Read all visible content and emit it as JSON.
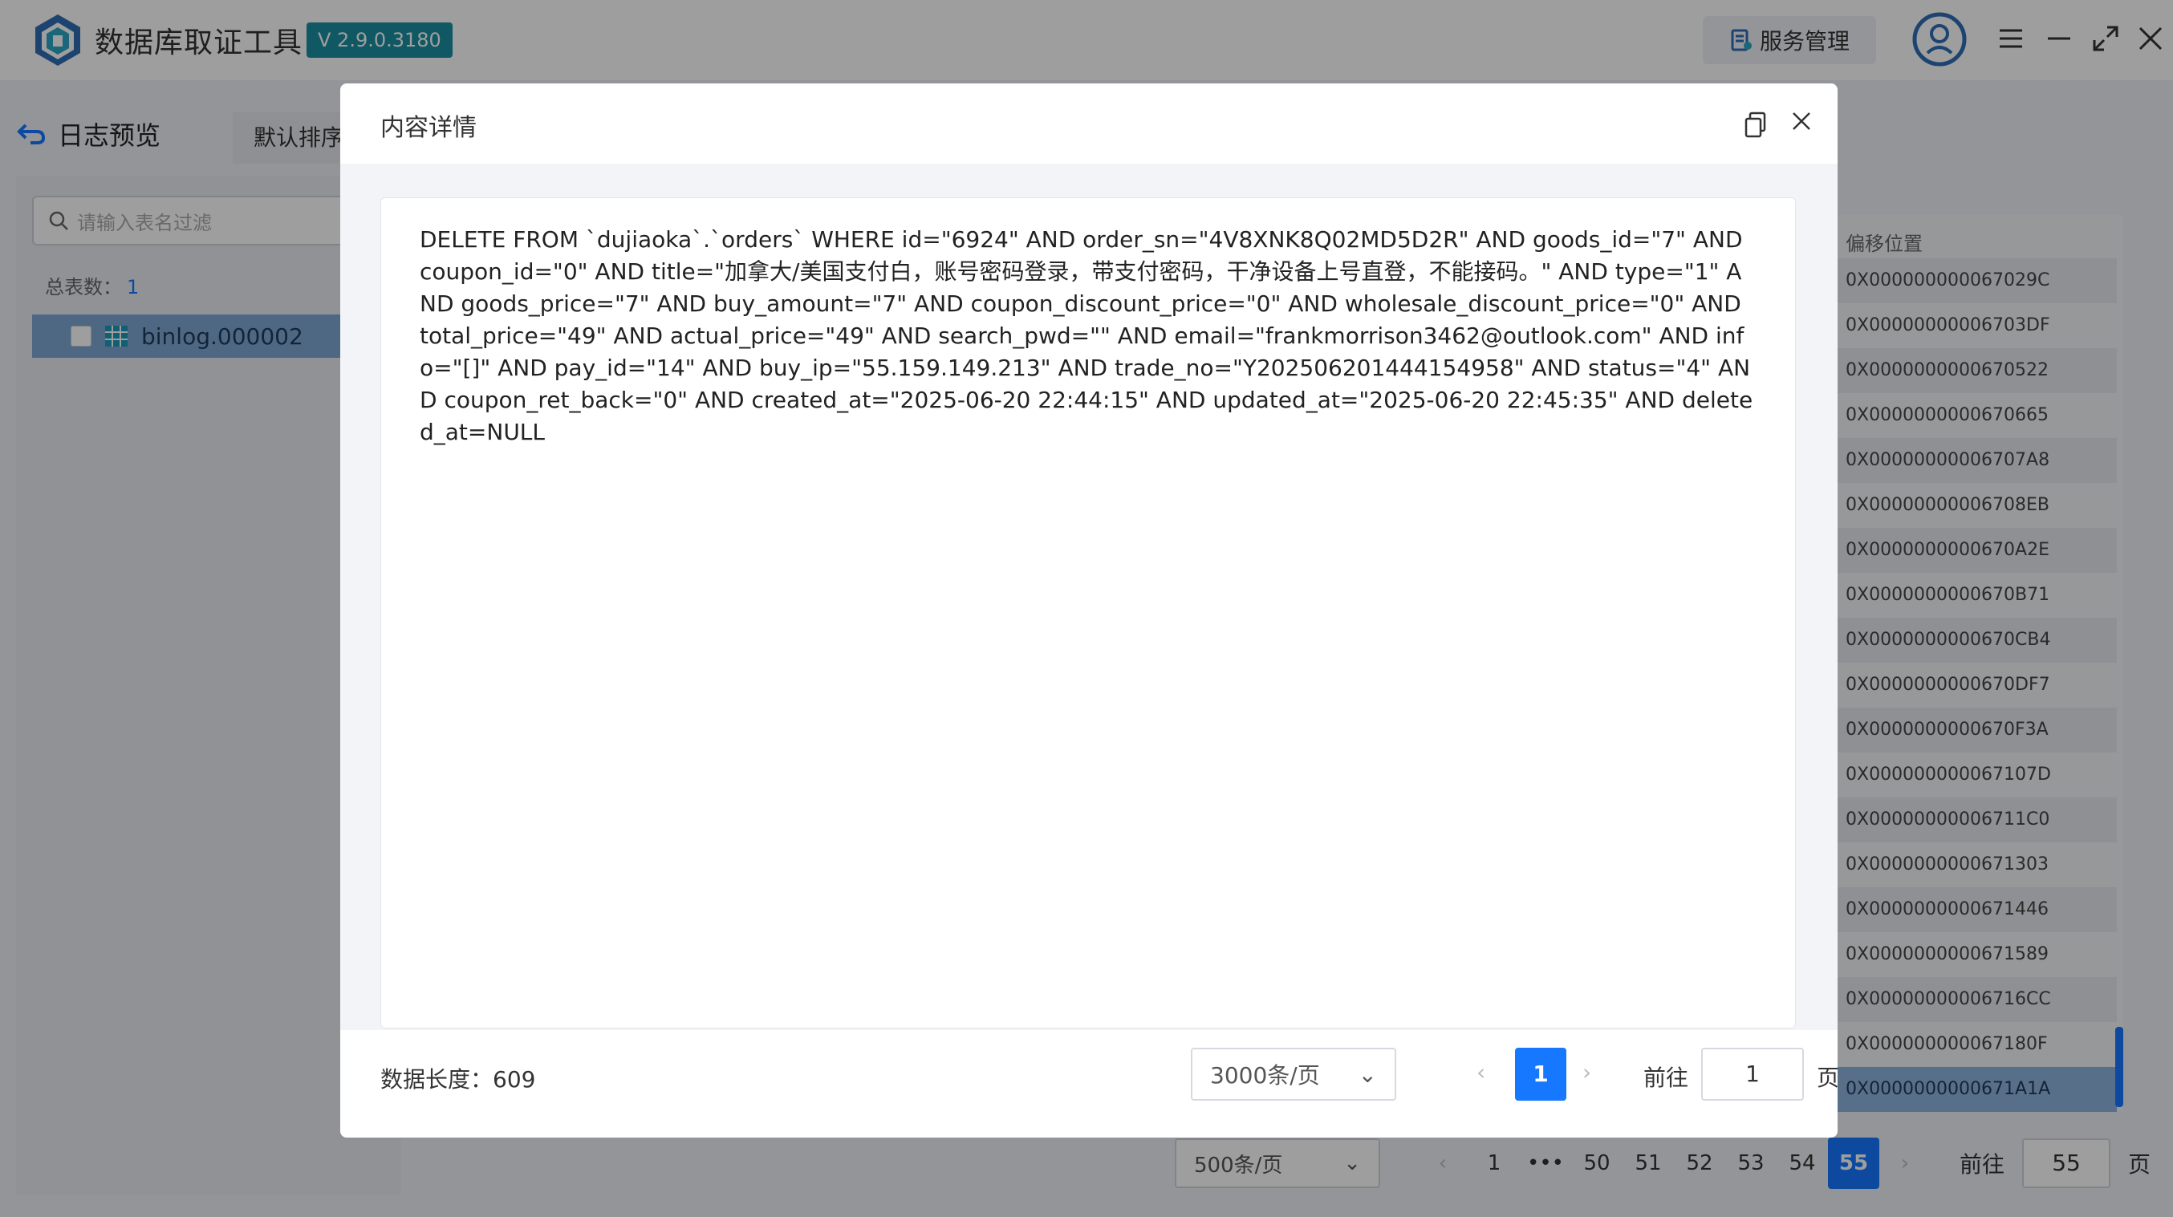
{
  "app": {
    "title": "数据库取证工具",
    "version": "V 2.9.0.3180",
    "service_button": "服务管理"
  },
  "page": {
    "back_label": "日志预览",
    "sort_tab": "默认排序",
    "filter_placeholder": "请输入表名过滤",
    "total_label": "总表数：",
    "total_count": "1",
    "tree_item": "binlog.000002",
    "offset_header": "偏移位置",
    "offsets": [
      "0X000000000067029C",
      "0X00000000006703DF",
      "0X0000000000670522",
      "0X0000000000670665",
      "0X00000000006707A8",
      "0X00000000006708EB",
      "0X0000000000670A2E",
      "0X0000000000670B71",
      "0X0000000000670CB4",
      "0X0000000000670DF7",
      "0X0000000000670F3A",
      "0X000000000067107D",
      "0X00000000006711C0",
      "0X0000000000671303",
      "0X0000000000671446",
      "0X0000000000671589",
      "0X00000000006716CC",
      "0X000000000067180F",
      "0X0000000000671A1A"
    ],
    "pager": {
      "page_size": "500条/页",
      "pages": [
        "1",
        "•••",
        "50",
        "51",
        "52",
        "53",
        "54",
        "55"
      ],
      "current": "55",
      "goto_label": "前往",
      "goto_value": "55",
      "page_suffix": "页"
    }
  },
  "dialog": {
    "title": "内容详情",
    "content": "DELETE FROM `dujiaoka`.`orders` WHERE id=\"6924\" AND order_sn=\"4V8XNK8Q02MD5D2R\" AND goods_id=\"7\" AND coupon_id=\"0\" AND title=\"加拿大/美国支付白，账号密码登录，带支付密码，干净设备上号直登，不能接码。\" AND type=\"1\" AND goods_price=\"7\" AND buy_amount=\"7\" AND coupon_discount_price=\"0\" AND wholesale_discount_price=\"0\" AND total_price=\"49\" AND actual_price=\"49\" AND search_pwd=\"\" AND email=\"frankmorrison3462@outlook.com\" AND info=\"[]\" AND pay_id=\"14\" AND buy_ip=\"55.159.149.213\" AND trade_no=\"Y202506201444154958\" AND status=\"4\" AND coupon_ret_back=\"0\" AND created_at=\"2025-06-20 22:44:15\" AND updated_at=\"2025-06-20 22:45:35\" AND deleted_at=NULL",
    "length_label": "数据长度：609",
    "page_size": "3000条/页",
    "current_page": "1",
    "goto_label": "前往",
    "goto_value": "1",
    "page_suffix": "页"
  },
  "colors": {
    "accent": "#1677ff",
    "version_badge": "#1b8ea0",
    "selected_row": "#8fb3dd"
  }
}
